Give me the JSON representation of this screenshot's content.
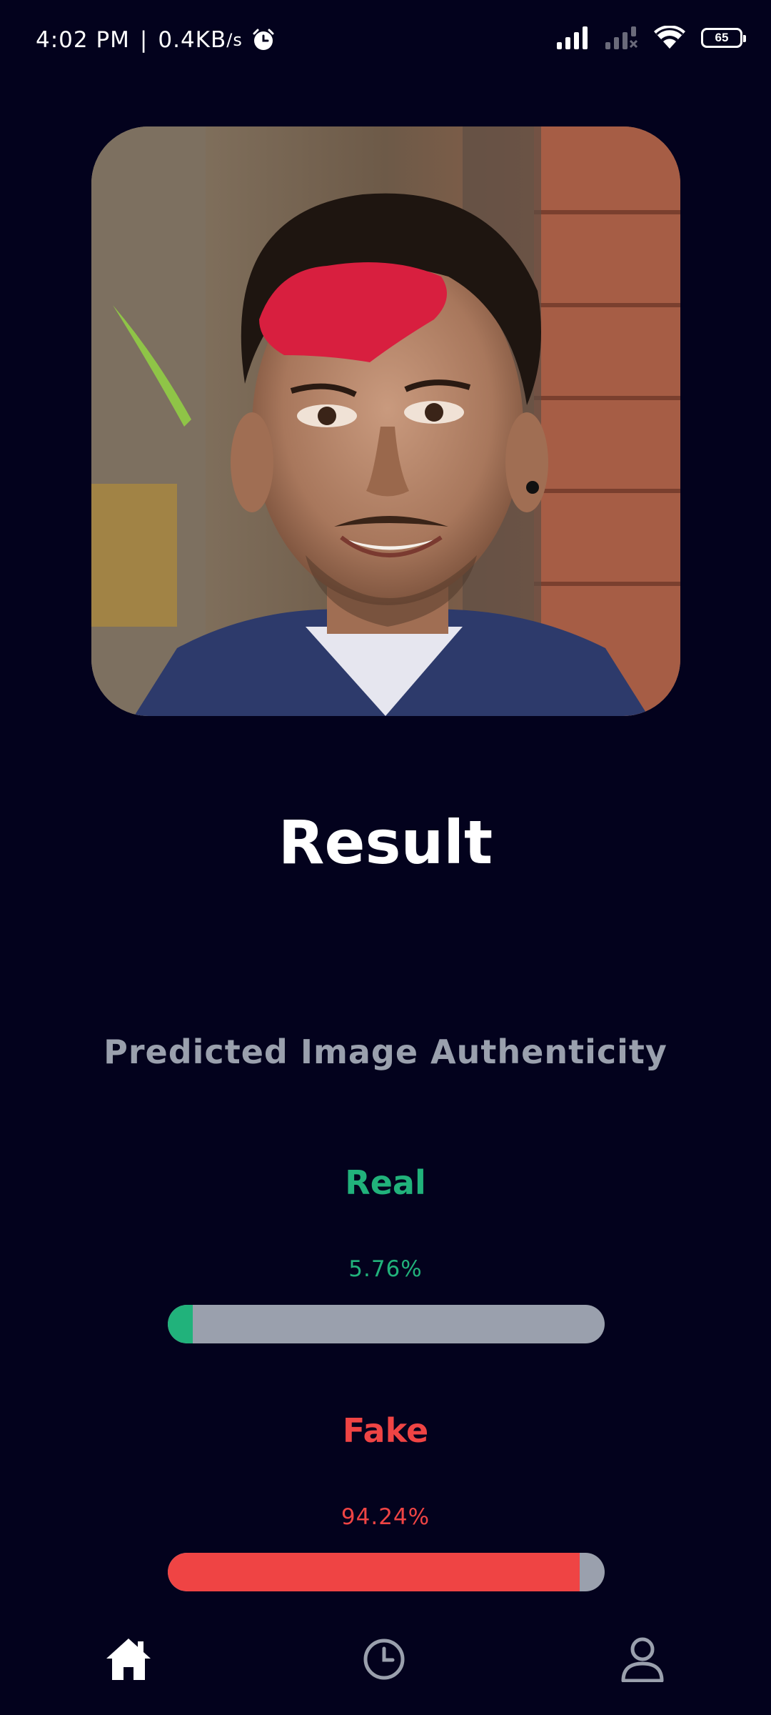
{
  "status_bar": {
    "time": "4:02 PM",
    "separator": "|",
    "speed": "0.4KB",
    "speed_unit": "/s",
    "battery": "65",
    "icons": [
      "alarm-icon",
      "signal-icon",
      "signal-no-service-icon",
      "wifi-icon",
      "battery-icon"
    ]
  },
  "photo": {
    "alt": "face-photo"
  },
  "result": {
    "title": "Result",
    "subtitle": "Predicted Image Authenticity"
  },
  "metrics": {
    "real": {
      "label": "Real",
      "value_text": "5.76%",
      "value": 5.76,
      "color": "#21b27b"
    },
    "fake": {
      "label": "Fake",
      "value_text": "94.24%",
      "value": 94.24,
      "color": "#ef4444"
    },
    "track_color": "#9aa0ad"
  },
  "nav": {
    "items": [
      {
        "name": "home",
        "icon": "home-icon",
        "active": true
      },
      {
        "name": "history",
        "icon": "clock-icon",
        "active": false
      },
      {
        "name": "profile",
        "icon": "user-icon",
        "active": false
      }
    ]
  },
  "colors": {
    "background": "#03021d",
    "subtitle": "#9aa0ad"
  }
}
